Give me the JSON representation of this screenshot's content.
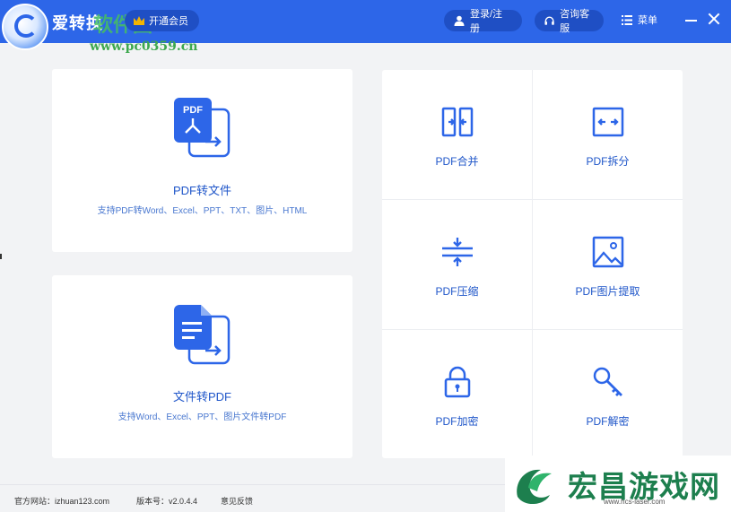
{
  "app": {
    "title": "爱转换",
    "watermark_text": "软件园",
    "vip_label": "开通会员",
    "watermark_url": "www.pc0359.cn"
  },
  "header": {
    "login_label": "登录/注册",
    "consult_label": "咨询客服",
    "menu_label": "菜单"
  },
  "cards": [
    {
      "title": "PDF转文件",
      "desc": "支持PDF转Word、Excel、PPT、TXT、图片、HTML",
      "icon": "pdf-to-file-icon"
    },
    {
      "title": "文件转PDF",
      "desc": "支持Word、Excel、PPT、图片文件转PDF",
      "icon": "file-to-pdf-icon"
    }
  ],
  "pdf_badge": "PDF",
  "tools": [
    {
      "label": "PDF合并",
      "icon": "merge-icon"
    },
    {
      "label": "PDF拆分",
      "icon": "split-icon"
    },
    {
      "label": "PDF压缩",
      "icon": "compress-icon"
    },
    {
      "label": "PDF图片提取",
      "icon": "image-extract-icon"
    },
    {
      "label": "PDF加密",
      "icon": "lock-icon"
    },
    {
      "label": "PDF解密",
      "icon": "key-icon"
    }
  ],
  "footer": {
    "website": "官方网站：izhuan123.com",
    "version": "版本号：v2.0.4.4",
    "feedback": "意见反馈"
  },
  "overlay_watermark": {
    "title": "宏昌游戏网",
    "url": "www.hcs-laser.com"
  },
  "colors": {
    "titlebar": "#2d66e8",
    "accent": "#1f56c9",
    "background": "#f2f3f5"
  }
}
